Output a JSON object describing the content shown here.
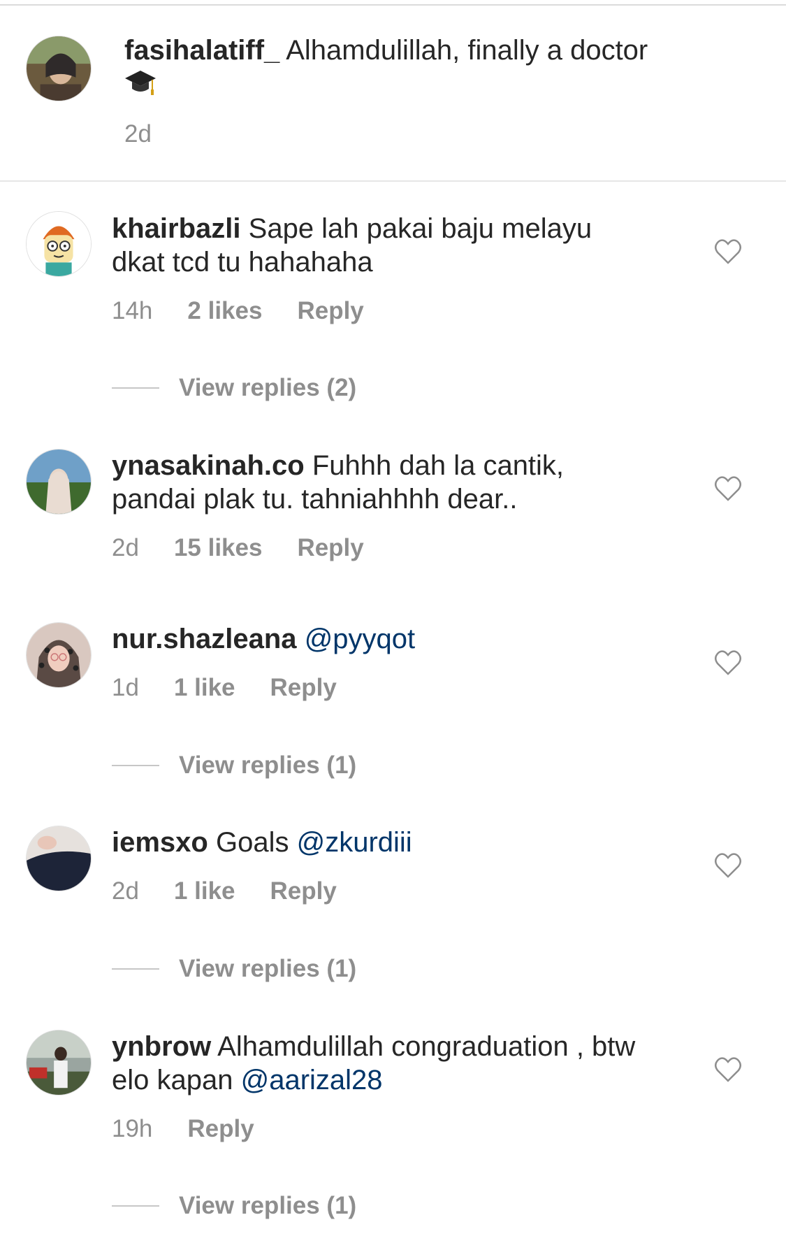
{
  "caption": {
    "username": "fasihalatiff_",
    "text": "Alhamdulillah, finally a doctor",
    "emoji": "graduation-cap-icon",
    "time": "2d"
  },
  "comments": [
    {
      "username": "khairbazli",
      "text": "Sape lah pakai baju melayu dkat tcd tu hahahaha",
      "time": "14h",
      "likes": "2 likes",
      "reply": "Reply",
      "view_replies": "View replies (2)"
    },
    {
      "username": "ynasakinah.co",
      "text": "Fuhhh dah la cantik, pandai plak tu. tahniahhhh dear..",
      "time": "2d",
      "likes": "15 likes",
      "reply": "Reply"
    },
    {
      "username": "nur.shazleana",
      "text": "",
      "mention": "@pyyqot",
      "time": "1d",
      "likes": "1 like",
      "reply": "Reply",
      "view_replies": "View replies (1)"
    },
    {
      "username": "iemsxo",
      "text": "Goals",
      "mention": "@zkurdiii",
      "time": "2d",
      "likes": "1 like",
      "reply": "Reply",
      "view_replies": "View replies (1)"
    },
    {
      "username": "ynbrow",
      "text": "Alhamdulillah congraduation , btw elo kapan",
      "mention": "@aarizal28",
      "time": "19h",
      "reply": "Reply",
      "view_replies": "View replies (1)"
    }
  ],
  "colors": {
    "text": "#262626",
    "secondary": "#8e8e8e",
    "mention": "#003569",
    "divider": "#dbdbdb"
  }
}
